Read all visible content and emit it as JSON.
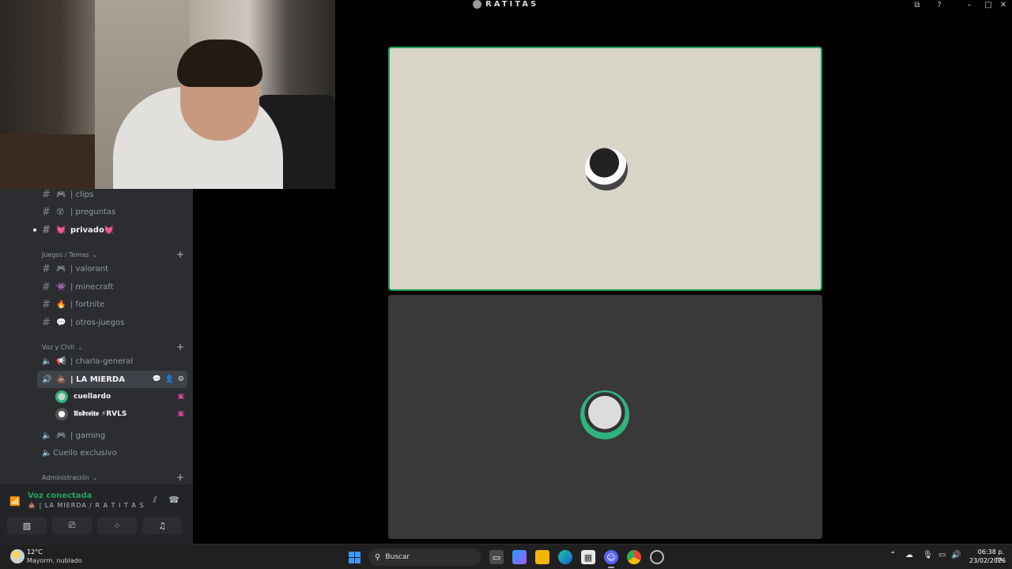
{
  "window": {
    "server_name": "RATITAS",
    "controls": [
      "–",
      "□",
      "✕"
    ]
  },
  "sidebar": {
    "channels_top": [
      {
        "emoji": "🎮",
        "label": "| clips"
      },
      {
        "emoji": "😵",
        "label": "| preguntas"
      },
      {
        "emoji": "💓",
        "label": "privado💓"
      }
    ],
    "categories": {
      "juegos": "Juegos / Temas",
      "voz": "Voz y Chill",
      "admin": "Administración"
    },
    "juegos_channels": [
      {
        "emoji": "🎮",
        "label": "| valorant"
      },
      {
        "emoji": "👾",
        "label": "| minecraft"
      },
      {
        "emoji": "🔥",
        "label": "| fortnite"
      },
      {
        "emoji": "💬",
        "label": "| otros-juegos"
      }
    ],
    "voice_channels": [
      {
        "emoji": "📢",
        "label": "| charla-general"
      },
      {
        "emoji": "💩",
        "label": "| LA MIERDA"
      },
      {
        "emoji": "🎮",
        "label": "| gaming"
      },
      {
        "emoji": "",
        "label": "Cuello exclusivo"
      }
    ],
    "members": [
      {
        "name": "cuellardo"
      },
      {
        "name": "𝖀𝖓𝖉𝖗𝖊𝖎𝖙𝖔 ⚡RVLS"
      }
    ]
  },
  "voice_panel": {
    "status": "Voz conectada",
    "channel": "💩 | LA MIERDA / R A T I T A S"
  },
  "taskbar": {
    "weather_temp": "12°C",
    "weather_desc": "Mayorm. nublado",
    "search_placeholder": "Buscar",
    "time": "06:38 p. m.",
    "date": "23/02/2026"
  },
  "colors": {
    "accent_green": "#23a55a",
    "sidebar_bg": "#2b2d31",
    "panel_bg": "#232428",
    "streaming_pink": "#eb459e"
  }
}
